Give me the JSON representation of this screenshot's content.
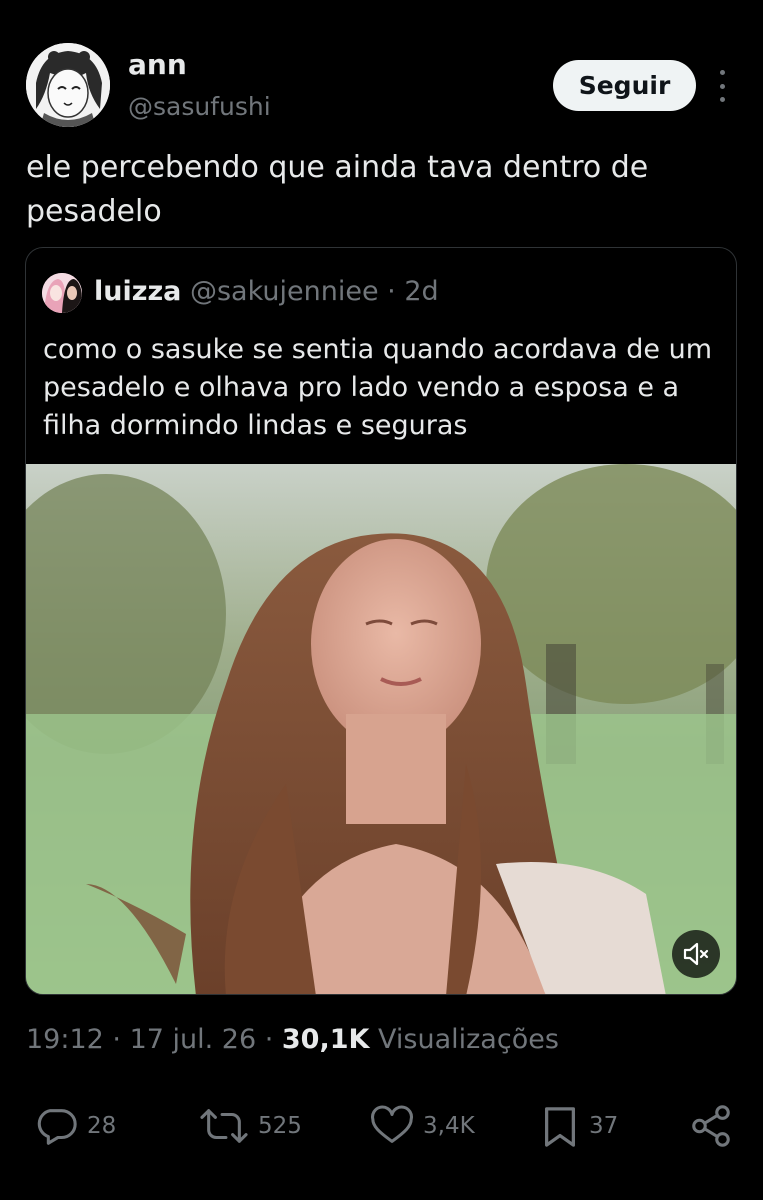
{
  "tweet": {
    "display_name": "ann",
    "handle": "@sasufushi",
    "follow_label": "Seguir",
    "text": "ele percebendo que ainda tava dentro de pesadelo"
  },
  "quoted": {
    "name": "luizza",
    "handle": "@sakujenniee",
    "separator": " · ",
    "age": "2d",
    "text": "como o sasuke se sentia quando acordava de um pesadelo e olhava pro lado vendo a esposa e a filha dormindo lindas e seguras"
  },
  "meta": {
    "time": "19:12",
    "sep1": " · ",
    "date": "17 jul. 26",
    "sep2": " · ",
    "views_count": "30,1K",
    "views_label": " Visualizações"
  },
  "actions": {
    "replies": "28",
    "reposts": "525",
    "likes": "3,4K",
    "bookmarks": "37"
  },
  "icons": [
    "avatar",
    "more-icon",
    "mute-icon",
    "reply-icon",
    "repost-icon",
    "like-icon",
    "bookmark-icon",
    "share-icon"
  ],
  "colors": {
    "background": "#000000",
    "text": "#e7e9ea",
    "secondary": "#71767b",
    "border": "#2f3336",
    "button_bg": "#eff3f4"
  }
}
